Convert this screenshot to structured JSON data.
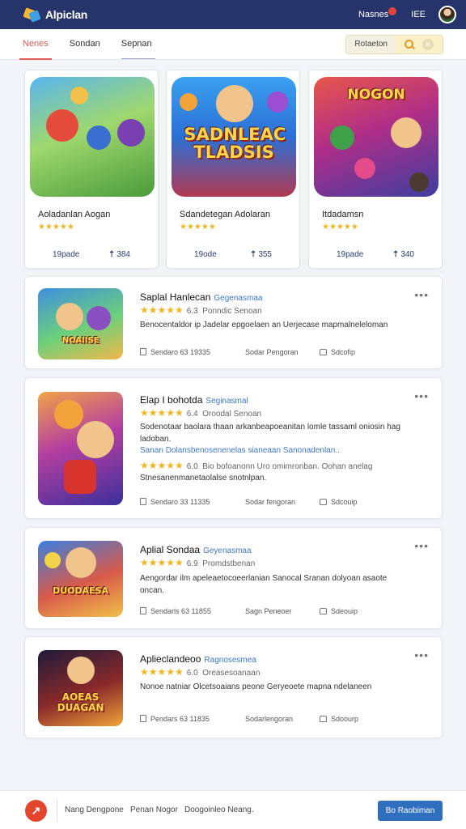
{
  "header": {
    "app_title": "Alpiclan",
    "user_name": "Nasnes",
    "user_code": "IEE"
  },
  "tabs": [
    {
      "label": "Nenes",
      "active": true
    },
    {
      "label": "Sondan",
      "active": false
    },
    {
      "label": "Sepnan",
      "active": false
    }
  ],
  "search": {
    "label": "Rotaeton"
  },
  "featured": [
    {
      "title": "Aoladanlan Aogan",
      "stars": "★★★★★",
      "stat_left": "19pade",
      "stat_right": "384"
    },
    {
      "title": "Sdandetegan Adolaran",
      "stars": "★★★★★",
      "stat_left": "19ode",
      "stat_right": "355",
      "art_text": "SADNLEAC TLADSIS"
    },
    {
      "title": "Itdadamsn",
      "stars": "★★★★★",
      "stat_left": "19pade",
      "stat_right": "340",
      "art_text": "NOGON"
    }
  ],
  "cards": [
    {
      "title": "Saplal Hanlecan",
      "subtitle": "Gegenasmaa",
      "stars": "★★★★★",
      "rating": "6.3",
      "meta": "Ponndic Senoan",
      "desc": "Benocentaldor ip Jadelar epgoelaen an Uerjecase mapmalneleloman",
      "footer_left": "Sendaro 63 19335",
      "footer_mid": "Sodar Pengoran",
      "footer_right": "Sdcofip",
      "art_text": "NOAIISE"
    },
    {
      "title": "Elap I bohotda",
      "subtitle": "Seginasmal",
      "stars": "★★★★★",
      "rating": "6.4",
      "meta": "Oroodal Senoan",
      "desc": "Sodenotaar baolara thaan arkanbeapoeanitan lomle tassaml oniosin hag ladoban.",
      "desc2": "Sanan Dolansbenosenenelas sianeaan Sanonadenlan..",
      "stars2": "★★★★★",
      "rating2": "6.0",
      "meta2": "Bio bofoanonn Uro omimronban. Oohan anelag",
      "meta3": "Stnesanenmanetaolalse snotnlpan.",
      "footer_left": "Sendaro 33 11335",
      "footer_mid": "Sodar fengoran",
      "footer_right": "Sdcouip"
    },
    {
      "title": "Aplial Sondaa",
      "subtitle": "Geyenasmaa",
      "stars": "★★★★★",
      "rating": "6.9",
      "meta": "Promdstbenan",
      "desc": "Aengordar ilm apeleaetocoeerlanian Sanocal Sranan dolyoan asaote oncan.",
      "footer_left": "Sendarls 63 11855",
      "footer_mid": "Sagn Peneoer",
      "footer_right": "Sdeouip",
      "art_text": "DUODAESA"
    },
    {
      "title": "Aplieclandeoo",
      "subtitle": "Ragnosesmea",
      "stars": "★★★★★",
      "rating": "6.0",
      "meta": "Oreasesoanaan",
      "desc": "Nonoe natniar Olcetsoaians peone Geryeoete mapna ndelaneen",
      "footer_left": "Pendars 63 11835",
      "footer_mid": "Sodarlengoran",
      "footer_right": "Sdoourp",
      "art_text": "AOEAS DUAGAN"
    }
  ],
  "footer": {
    "text1": "Nang Dengpone",
    "text2": "Penan Nogor",
    "text3": "Doogoinleo Neang.",
    "button": "Bo Raobiman"
  },
  "colors": {
    "header_bg": "#27346b",
    "accent_red": "#e25a52",
    "link_blue": "#3c78c8",
    "star": "#f2b51d",
    "button_blue": "#2f6fc0"
  }
}
